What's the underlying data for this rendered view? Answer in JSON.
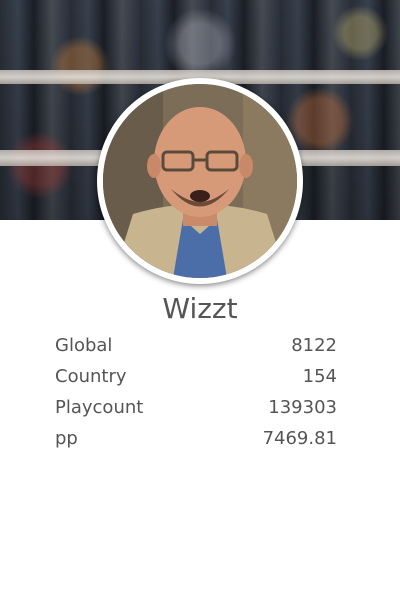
{
  "profile": {
    "username": "Wizzt",
    "stats": [
      {
        "label": "Global",
        "value": "8122"
      },
      {
        "label": "Country",
        "value": "154"
      },
      {
        "label": "Playcount",
        "value": "139303"
      },
      {
        "label": "pp",
        "value": "7469.81"
      }
    ]
  },
  "colors": {
    "text": "#555555",
    "background": "#ffffff",
    "ring": "#ffffff"
  }
}
